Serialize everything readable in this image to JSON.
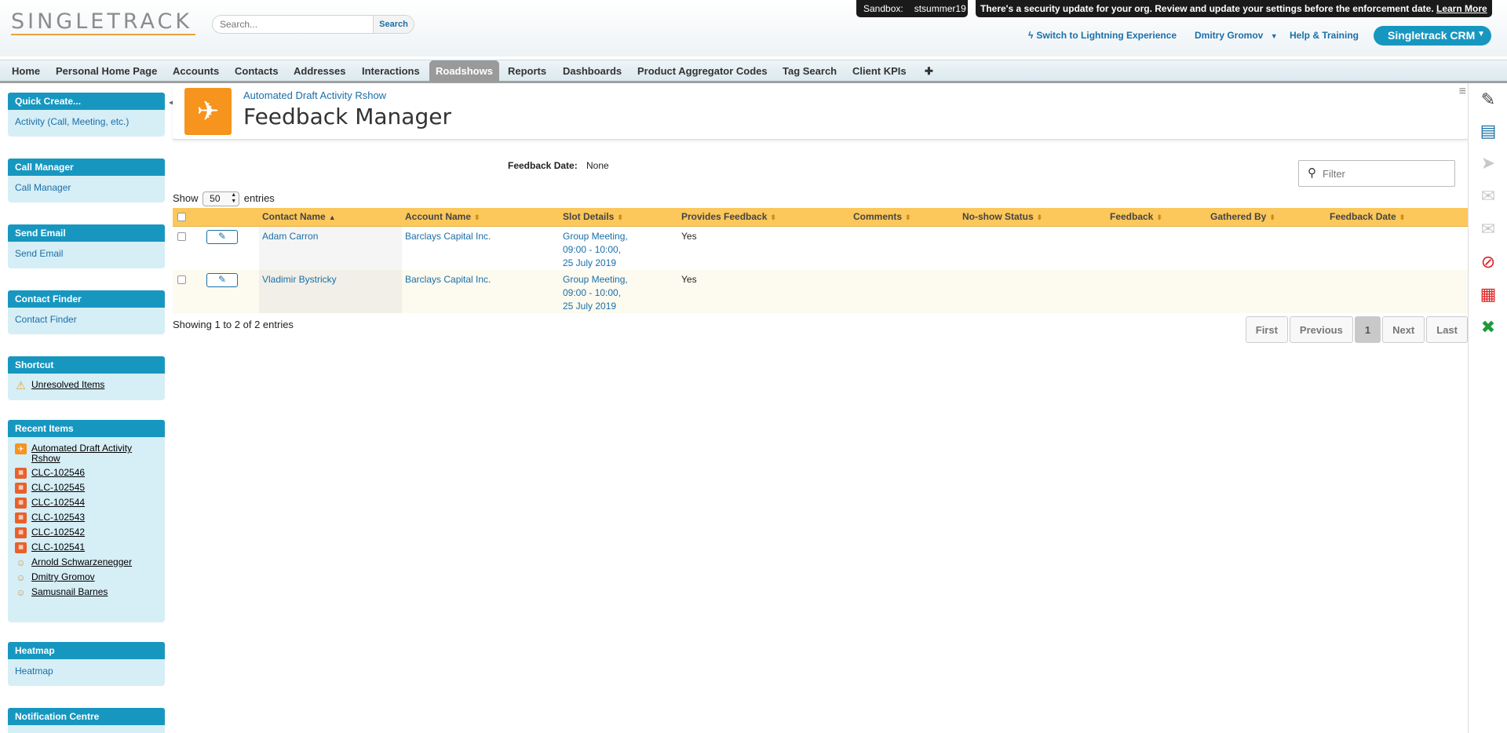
{
  "header": {
    "logo": "SINGLETRACK",
    "search_placeholder": "Search...",
    "search_button": "Search",
    "sandbox_label": "Sandbox:",
    "sandbox_value": "stsummer19",
    "security_message": "There's a security update for your org. Review and update your settings before the enforcement date.",
    "security_link": "Learn More",
    "lightning_link": "Switch to Lightning Experience",
    "user_name": "Dmitry Gromov",
    "help_link": "Help & Training",
    "app_name": "Singletrack CRM"
  },
  "tabs": [
    {
      "label": "Home"
    },
    {
      "label": "Personal Home Page"
    },
    {
      "label": "Accounts"
    },
    {
      "label": "Contacts"
    },
    {
      "label": "Addresses"
    },
    {
      "label": "Interactions"
    },
    {
      "label": "Roadshows"
    },
    {
      "label": "Reports"
    },
    {
      "label": "Dashboards"
    },
    {
      "label": "Product Aggregator Codes"
    },
    {
      "label": "Tag Search"
    },
    {
      "label": "Client KPIs"
    },
    {
      "label": "✚"
    }
  ],
  "sidebar": {
    "quick_create": {
      "title": "Quick Create...",
      "link": "Activity (Call, Meeting, etc.)"
    },
    "call_manager": {
      "title": "Call Manager",
      "link": "Call Manager"
    },
    "send_email": {
      "title": "Send Email",
      "link": "Send Email"
    },
    "contact_finder": {
      "title": "Contact Finder",
      "link": "Contact Finder"
    },
    "shortcut": {
      "title": "Shortcut",
      "item": "Unresolved Items"
    },
    "recent_items": {
      "title": "Recent Items",
      "items": [
        {
          "label": "Automated Draft Activity Rshow",
          "icon": "roadshow-icon"
        },
        {
          "label": "CLC-102546",
          "icon": "clc-icon"
        },
        {
          "label": "CLC-102545",
          "icon": "clc-icon"
        },
        {
          "label": "CLC-102544",
          "icon": "clc-icon"
        },
        {
          "label": "CLC-102543",
          "icon": "clc-icon"
        },
        {
          "label": "CLC-102542",
          "icon": "clc-icon"
        },
        {
          "label": "CLC-102541",
          "icon": "clc-icon"
        },
        {
          "label": "Arnold Schwarzenegger",
          "icon": "contact-icon"
        },
        {
          "label": "Dmitry Gromov",
          "icon": "contact-icon"
        },
        {
          "label": "Samusnail Barnes",
          "icon": "contact-icon"
        }
      ]
    },
    "heatmap": {
      "title": "Heatmap",
      "link": "Heatmap"
    },
    "notification_centre": {
      "title": "Notification Centre"
    }
  },
  "page": {
    "record_name": "Automated Draft Activity Rshow",
    "title": "Feedback Manager",
    "feedback_date_label": "Feedback Date:",
    "feedback_date_value": "None",
    "filter_placeholder": "Filter",
    "show_label": "Show",
    "show_value": "50",
    "entries_label": "entries",
    "showing_info": "Showing 1 to 2 of 2 entries"
  },
  "table": {
    "columns": [
      "Contact Name",
      "Account Name",
      "Slot Details",
      "Provides Feedback",
      "Comments",
      "No-show Status",
      "Feedback",
      "Gathered By",
      "Feedback Date"
    ],
    "rows": [
      {
        "contact": "Adam Carron",
        "account": "Barclays Capital Inc.",
        "slot_line1": "Group Meeting,",
        "slot_line2": "09:00 - 10:00,",
        "slot_line3": "25 July 2019",
        "provides_feedback": "Yes"
      },
      {
        "contact": "Vladimir Bystricky",
        "account": "Barclays Capital Inc.",
        "slot_line1": "Group Meeting,",
        "slot_line2": "09:00 - 10:00,",
        "slot_line3": "25 July 2019",
        "provides_feedback": "Yes"
      }
    ]
  },
  "pagination": {
    "first": "First",
    "previous": "Previous",
    "current": "1",
    "next": "Next",
    "last": "Last"
  },
  "colors": {
    "accent_blue": "#1797c0",
    "link_blue": "#1a6fa8",
    "table_header": "#fcc75b",
    "roadshow_orange": "#f7941d"
  }
}
